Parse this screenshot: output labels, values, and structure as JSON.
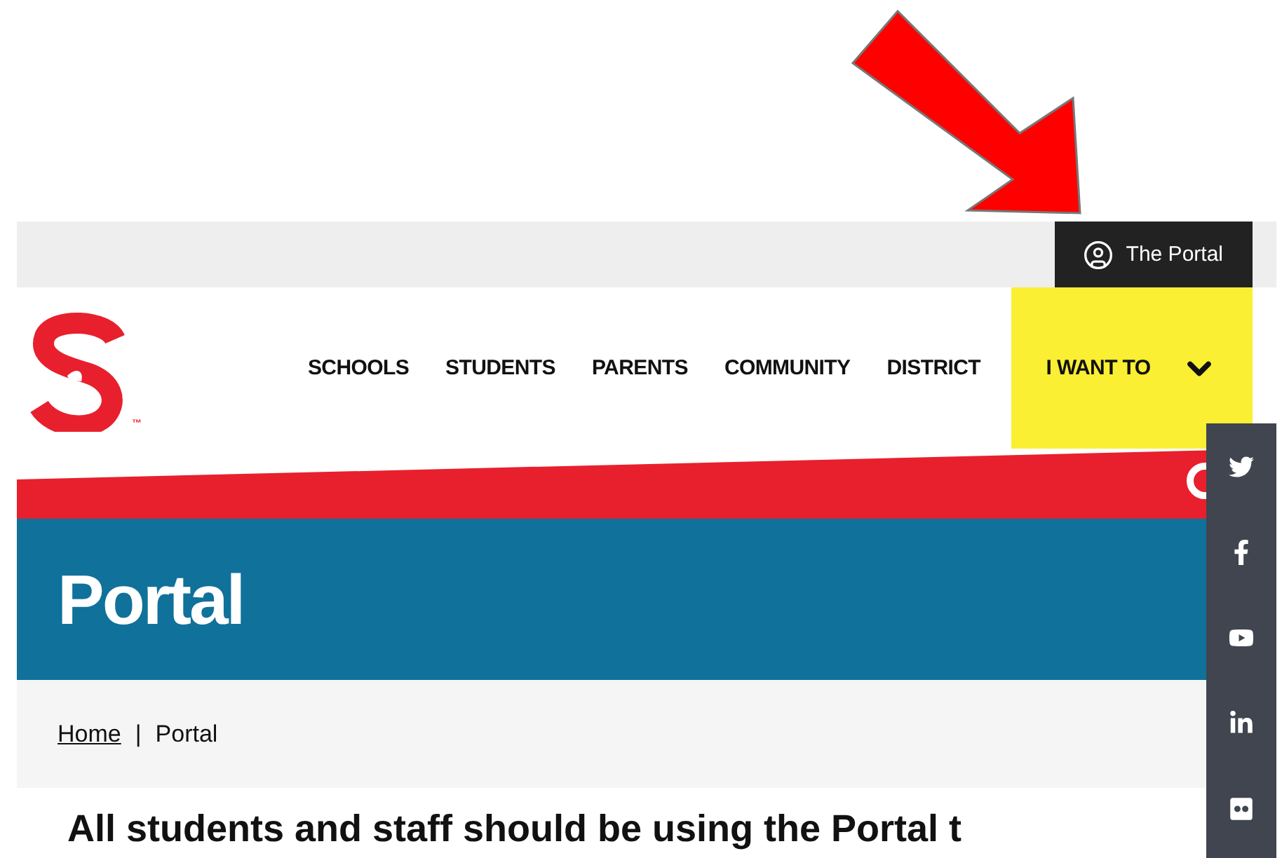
{
  "top_bar": {
    "portal_link": "The Portal"
  },
  "header": {
    "logo_mark": "™",
    "nav": [
      "SCHOOLS",
      "STUDENTS",
      "PARENTS",
      "COMMUNITY",
      "DISTRICT"
    ],
    "cta": "I WANT TO"
  },
  "banner": {
    "title": "Portal"
  },
  "breadcrumb": {
    "items": [
      {
        "label": "Home",
        "kind": "link"
      },
      {
        "label": "Portal",
        "kind": "current"
      }
    ],
    "separator": "|"
  },
  "heading": "All students and staff should be using the Portal t",
  "social": [
    {
      "kind": "twitter"
    },
    {
      "kind": "facebook"
    },
    {
      "kind": "youtube"
    },
    {
      "kind": "linkedin"
    },
    {
      "kind": "flickr"
    }
  ]
}
